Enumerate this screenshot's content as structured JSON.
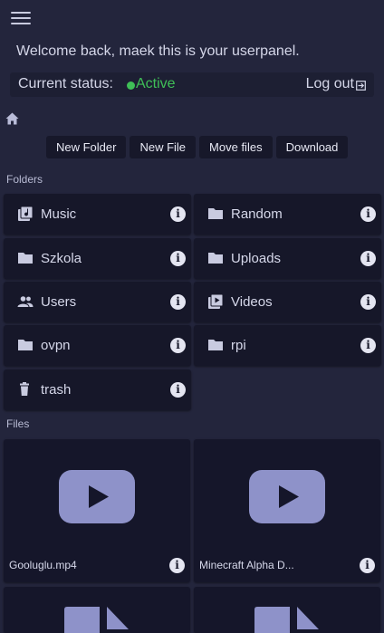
{
  "header": {
    "menu_icon": "hamburger-menu-icon",
    "welcome": "Welcome back, maek this is your userpanel."
  },
  "status": {
    "label": "Current status:",
    "value": "Active",
    "value_color": "#3fbf57",
    "logout_label": "Log out",
    "logout_icon": "logout-icon"
  },
  "breadcrumb": {
    "home_icon": "home-icon"
  },
  "toolbar": {
    "new_folder": "New Folder",
    "new_file": "New File",
    "move_files": "Move files",
    "download": "Download"
  },
  "folders_label": "Folders",
  "folders": [
    {
      "name": "Music",
      "icon": "music-library-icon"
    },
    {
      "name": "Random",
      "icon": "folder-icon"
    },
    {
      "name": "Szkola",
      "icon": "folder-icon"
    },
    {
      "name": "Uploads",
      "icon": "folder-icon"
    },
    {
      "name": "Users",
      "icon": "users-icon"
    },
    {
      "name": "Videos",
      "icon": "video-library-icon"
    },
    {
      "name": "ovpn",
      "icon": "folder-icon"
    },
    {
      "name": "rpi",
      "icon": "folder-icon"
    },
    {
      "name": "trash",
      "icon": "trash-icon"
    }
  ],
  "files_label": "Files",
  "files": [
    {
      "name": "Gooluglu.mp4",
      "icon": "video-play-icon"
    },
    {
      "name": "Minecraft Alpha D...",
      "icon": "video-play-icon"
    },
    {
      "name": "",
      "icon": "file-document-icon"
    },
    {
      "name": "",
      "icon": "file-document-icon"
    }
  ],
  "colors": {
    "background": "#23253c",
    "card": "#161729",
    "thumb": "#8e92c9",
    "accent_active": "#3fbf57"
  }
}
